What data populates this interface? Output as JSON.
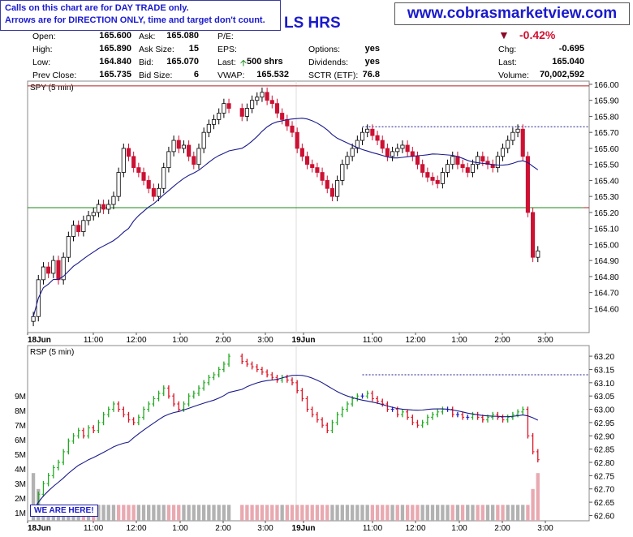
{
  "notice": {
    "line1": "Calls on this chart are for DAY TRADE only.",
    "line2": "Arrows are for DIRECTION ONLY, time and target don't count."
  },
  "site": "www.cobrasmarketview.com",
  "title_fragment": "LS HRS",
  "quote": {
    "open_label": "Open:",
    "open": "165.600",
    "high_label": "High:",
    "high": "165.890",
    "low_label": "Low:",
    "low": "164.840",
    "prev_label": "Prev Close:",
    "prev": "165.735",
    "ask_label": "Ask:",
    "ask": "165.080",
    "asksize_label": "Ask Size:",
    "asksize": "15",
    "bid_label": "Bid:",
    "bid": "165.070",
    "bidsize_label": "Bid Size:",
    "bidsize": "6",
    "pe_label": "P/E:",
    "eps_label": "EPS:",
    "last_label": "Last:",
    "last_size": "500 shrs",
    "vwap_label": "VWAP:",
    "vwap": "165.532",
    "options_label": "Options:",
    "options": "yes",
    "dividends_label": "Dividends:",
    "dividends": "yes",
    "sctr_label": "SCTR (ETF):",
    "sctr": "76.8",
    "change_pct": "-0.42%",
    "chg_label": "Chg:",
    "chg": "-0.695",
    "last2_label": "Last:",
    "last2": "165.040",
    "volume_label": "Volume:",
    "volume": "70,002,592"
  },
  "here_label": "WE ARE HERE!",
  "colors": {
    "up": "#000000",
    "down": "#cc1133",
    "ma": "#1a1a8c",
    "red_line": "#b22222",
    "green_line": "#1a8a1a",
    "rsp_up": "#22aa22",
    "rsp_neutral": "#1a1acc",
    "rsp_down": "#dd1122"
  },
  "chart_data": [
    {
      "type": "candlestick",
      "title": "SPY (5 min)",
      "ylim": [
        164.45,
        166.02
      ],
      "yticks": [
        "166.00",
        "165.90",
        "165.80",
        "165.70",
        "165.60",
        "165.50",
        "165.40",
        "165.30",
        "165.20",
        "165.10",
        "165.00",
        "164.90",
        "164.80",
        "164.70",
        "164.60"
      ],
      "xticks": [
        "18Jun",
        "11:00",
        "12:00",
        "1:00",
        "2:00",
        "3:00",
        "19Jun",
        "11:00",
        "12:00",
        "1:00",
        "2:00",
        "3:00"
      ],
      "grid": false,
      "hlines": [
        {
          "value": 165.99,
          "color": "red"
        },
        {
          "value": 165.735,
          "color": "blue",
          "style": "dotted",
          "from_bar": 64
        },
        {
          "value": 165.23,
          "color": "green",
          "to_bar": 108
        },
        {
          "value": 165.23,
          "color": "red",
          "from_bar": 108
        }
      ],
      "closes": [
        164.55,
        164.78,
        164.86,
        164.82,
        164.9,
        164.78,
        164.92,
        165.05,
        165.12,
        165.08,
        165.15,
        165.18,
        165.2,
        165.25,
        165.22,
        165.25,
        165.3,
        165.45,
        165.6,
        165.55,
        165.48,
        165.45,
        165.4,
        165.35,
        165.3,
        165.35,
        165.48,
        165.58,
        165.65,
        165.6,
        165.62,
        165.55,
        165.5,
        165.6,
        165.7,
        165.75,
        165.78,
        165.82,
        165.88,
        165.85,
        165.8,
        165.85,
        165.9,
        165.92,
        165.95,
        165.9,
        165.88,
        165.82,
        165.78,
        165.74,
        165.7,
        165.6,
        165.55,
        165.5,
        165.48,
        165.45,
        165.4,
        165.35,
        165.3,
        165.4,
        165.5,
        165.55,
        165.6,
        165.65,
        165.7,
        165.72,
        165.68,
        165.65,
        165.6,
        165.55,
        165.58,
        165.6,
        165.62,
        165.58,
        165.55,
        165.5,
        165.45,
        165.42,
        165.4,
        165.38,
        165.45,
        165.5,
        165.55,
        165.5,
        165.48,
        165.45,
        165.5,
        165.55,
        165.52,
        165.5,
        165.48,
        165.55,
        165.6,
        165.65,
        165.7,
        165.72,
        165.55,
        165.2,
        164.92,
        164.96
      ],
      "ma_note": "20-period moving average (blue)"
    },
    {
      "type": "bar",
      "title": "RSP (5 min)",
      "ylim": [
        62.58,
        63.24
      ],
      "yticks": [
        "63.20",
        "63.15",
        "63.10",
        "63.05",
        "63.00",
        "62.95",
        "62.90",
        "62.85",
        "62.80",
        "62.75",
        "62.70",
        "62.65",
        "62.60"
      ],
      "volume_ticks": [
        "9M",
        "8M",
        "7M",
        "6M",
        "5M",
        "4M",
        "3M",
        "2M",
        "1M"
      ],
      "xticks": [
        "18Jun",
        "11:00",
        "12:00",
        "1:00",
        "2:00",
        "3:00",
        "19Jun",
        "11:00",
        "12:00",
        "1:00",
        "2:00",
        "3:00"
      ],
      "hlines": [
        {
          "value": 63.13,
          "color": "blue",
          "style": "dotted",
          "from_bar": 64
        }
      ],
      "closes": [
        62.62,
        62.68,
        62.72,
        62.75,
        62.78,
        62.8,
        62.84,
        62.88,
        62.9,
        62.92,
        62.9,
        62.93,
        62.92,
        62.95,
        62.98,
        63.0,
        63.02,
        63.0,
        62.98,
        62.96,
        62.95,
        62.97,
        63.0,
        63.02,
        63.04,
        63.06,
        63.08,
        63.05,
        63.02,
        63.0,
        63.02,
        63.05,
        63.06,
        63.08,
        63.1,
        63.12,
        63.13,
        63.15,
        63.17,
        63.2,
        63.18,
        63.17,
        63.16,
        63.15,
        63.14,
        63.13,
        63.12,
        63.11,
        63.12,
        63.11,
        63.1,
        63.07,
        63.04,
        63.0,
        62.98,
        62.96,
        62.94,
        62.92,
        62.95,
        62.98,
        63.0,
        63.02,
        63.04,
        63.05,
        63.05,
        63.06,
        63.04,
        63.03,
        63.02,
        63.0,
        63.0,
        62.98,
        62.99,
        62.97,
        62.95,
        62.94,
        62.95,
        62.97,
        62.98,
        62.99,
        63.0,
        63.0,
        62.98,
        62.98,
        62.97,
        62.97,
        62.98,
        62.97,
        62.96,
        62.97,
        62.98,
        62.97,
        62.96,
        62.97,
        62.98,
        62.99,
        63.0,
        62.9,
        62.84,
        62.81
      ],
      "volume_millions": [
        3,
        2,
        1,
        1,
        1,
        1,
        1,
        1,
        1,
        1,
        1,
        1,
        1,
        1,
        1,
        1,
        1,
        1,
        1,
        1,
        1,
        1,
        1,
        1,
        1,
        1,
        1,
        1,
        1,
        1,
        1,
        1,
        1,
        1,
        1,
        1,
        1,
        1,
        1,
        1,
        1,
        1,
        1,
        1,
        1,
        1,
        1,
        1,
        1,
        1,
        1,
        1,
        1,
        1,
        1,
        1,
        1,
        1,
        1,
        1,
        1,
        1,
        1,
        1,
        1,
        1,
        1,
        1,
        1,
        1,
        1,
        1,
        1,
        1,
        1,
        1,
        1,
        1,
        1,
        1,
        1,
        1,
        1,
        1,
        1,
        1,
        1,
        1,
        1,
        1,
        1,
        1,
        1,
        1,
        1,
        1,
        1,
        1,
        2,
        3
      ]
    }
  ]
}
